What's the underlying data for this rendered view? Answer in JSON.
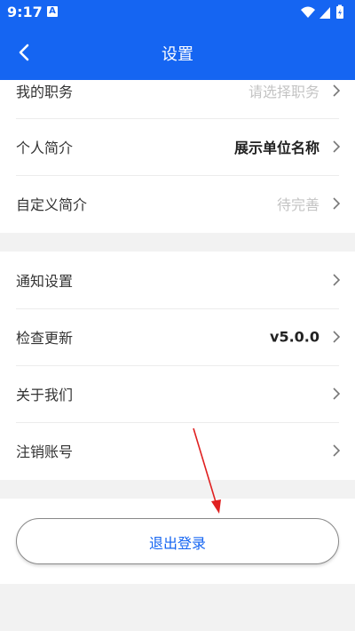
{
  "status_bar": {
    "time": "9:17",
    "notification_badge": "A"
  },
  "nav": {
    "title": "设置",
    "back_icon": "chevron-left-icon"
  },
  "profile_section": [
    {
      "label": "我的职务",
      "value": "请选择职务",
      "style": "placeholder"
    },
    {
      "label": "个人简介",
      "value": "展示单位名称",
      "style": "bold"
    },
    {
      "label": "自定义简介",
      "value": "待完善",
      "style": "placeholder"
    }
  ],
  "settings_section": [
    {
      "label": "通知设置",
      "value": ""
    },
    {
      "label": "检查更新",
      "value": "v5.0.0"
    },
    {
      "label": "关于我们",
      "value": ""
    },
    {
      "label": "注销账号",
      "value": ""
    }
  ],
  "logout": {
    "label": "退出登录"
  },
  "colors": {
    "brand": "#1565f2",
    "annotation_arrow": "#e02020"
  }
}
